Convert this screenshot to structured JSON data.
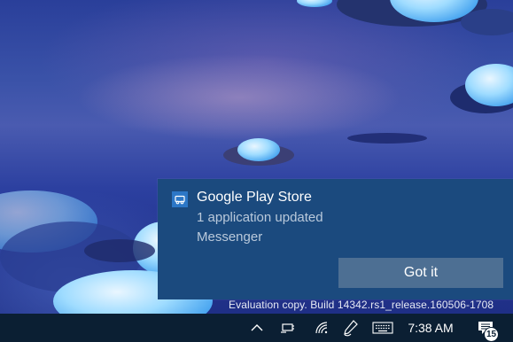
{
  "notification": {
    "app_name": "Google Play Store",
    "line1": "1 application updated",
    "line2": "Messenger",
    "action_label": "Got it"
  },
  "desktop": {
    "watermark": "Evaluation copy. Build 14342.rs1_release.160506-1708"
  },
  "taskbar": {
    "show_hidden_icon": "chevron-up-icon",
    "clock": "7:38 AM",
    "notification_count": "15"
  },
  "colors": {
    "notification_bg": "#1b4a7e",
    "action_button_bg": "#4d6f93",
    "taskbar_bg": "#0b1f33"
  }
}
